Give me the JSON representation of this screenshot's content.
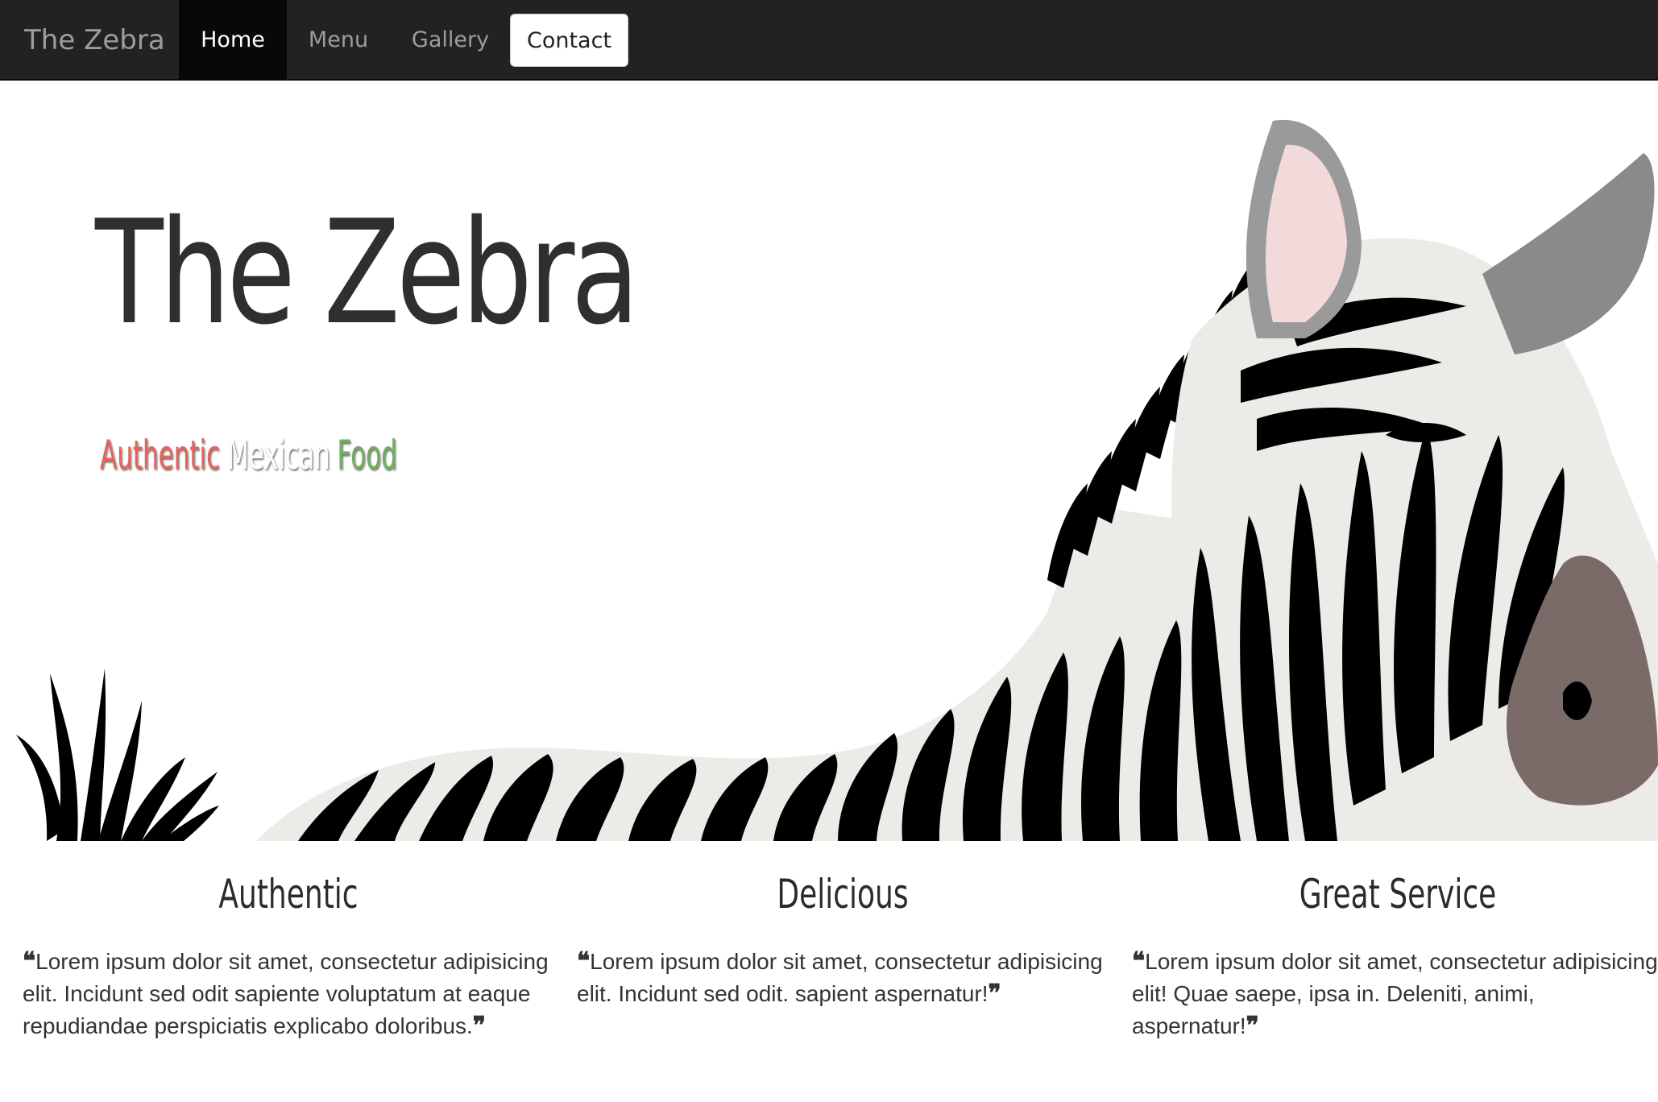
{
  "navbar": {
    "brand": "The Zebra",
    "items": {
      "home": "Home",
      "menu": "Menu",
      "gallery": "Gallery",
      "contact": "Contact"
    },
    "active": "Home"
  },
  "hero": {
    "title": "The Zebra",
    "subtitle": {
      "word1": "Authentic",
      "word2": "Mexican",
      "word3": "Food"
    },
    "subtitle_colors": {
      "word1": "#e8625a",
      "word2": "#ffffff",
      "word3": "#6fae5c"
    },
    "image": "zebra-illustration"
  },
  "features": [
    {
      "heading": "Authentic",
      "text": "Lorem ipsum dolor sit amet, consectetur adipisicing elit. Incidunt sed odit sapiente voluptatum at eaque repudiandae perspiciatis explicabo doloribus."
    },
    {
      "heading": "Delicious",
      "text": "Lorem ipsum dolor sit amet, consectetur adipisicing elit. Incidunt sed odit. sapient aspernatur!"
    },
    {
      "heading": "Great Service",
      "text": "Lorem ipsum dolor sit amet, consectetur adipisicing elit! Quae saepe, ipsa in. Deleniti, animi, aspernatur!"
    }
  ],
  "quotes": {
    "open": "❝",
    "close": "❞"
  },
  "colors": {
    "navbar_bg": "#222222",
    "navbar_active_bg": "#080808",
    "nav_text": "#9d9d9d"
  }
}
